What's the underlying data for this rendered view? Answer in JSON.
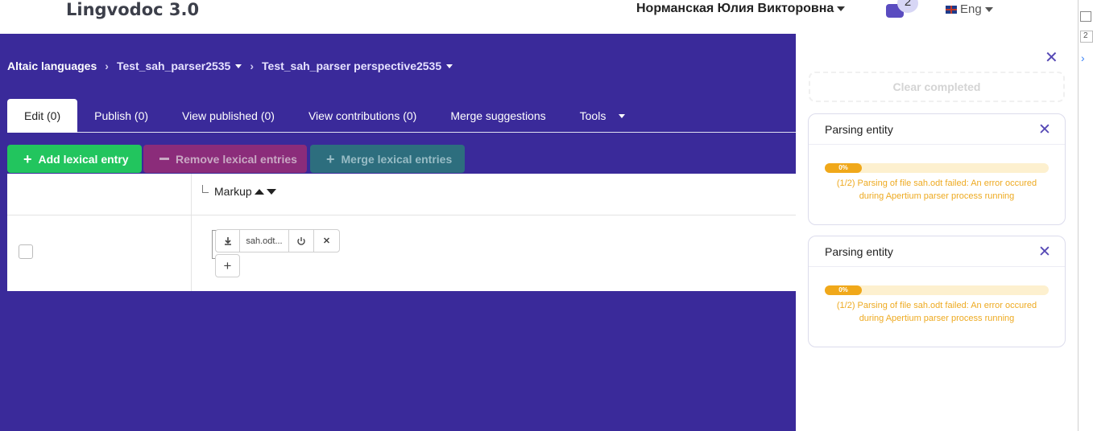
{
  "app": {
    "title": "Lingvodoc 3.0"
  },
  "header": {
    "user_name": "Норманская Юлия Викторовна",
    "notifications_count": "2",
    "language": "Eng"
  },
  "breadcrumb": [
    {
      "label": "Altaic languages"
    },
    {
      "label": "Test_sah_parser2535"
    },
    {
      "label": "Test_sah_parser perspective2535"
    }
  ],
  "tabs": [
    {
      "label": "Edit (0)",
      "active": true
    },
    {
      "label": "Publish (0)"
    },
    {
      "label": "View published (0)"
    },
    {
      "label": "View contributions (0)"
    },
    {
      "label": "Merge suggestions"
    },
    {
      "label": "Tools"
    }
  ],
  "toolbar": {
    "add_label": "Add lexical entry",
    "remove_label": "Remove lexical entries",
    "merge_label": "Merge lexical entries"
  },
  "table": {
    "column_markup": "Markup",
    "rows": [
      {
        "file_name": "sah.odt..."
      }
    ]
  },
  "tasks_panel": {
    "clear_label": "Clear completed",
    "tasks": [
      {
        "title": "Parsing entity",
        "progress_label": "0%",
        "progress": 0,
        "message": "(1/2) Parsing of file sah.odt failed: An error occured during Apertium parser process running"
      },
      {
        "title": "Parsing entity",
        "progress_label": "0%",
        "progress": 0,
        "message": "(1/2) Parsing of file sah.odt failed: An error occured during Apertium parser process running"
      }
    ]
  },
  "devtools": {
    "strip_number": "2"
  },
  "colors": {
    "background": "#3a2a9a",
    "add_button": "#22c55e",
    "remove_button": "#8b2c7a",
    "merge_button": "#2d6e7e",
    "progress": "#f0a81a",
    "warning_text": "#eeaa21"
  }
}
